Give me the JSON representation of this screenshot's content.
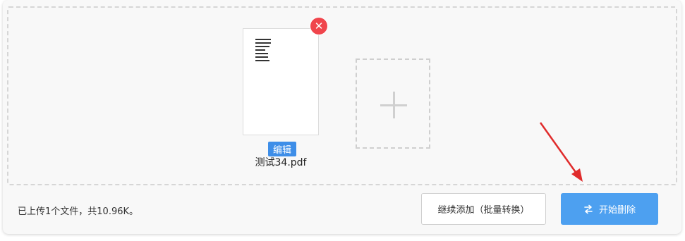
{
  "file": {
    "name": "测试34.pdf",
    "edit_label": "编辑",
    "remove_icon": "close-icon",
    "remove_symbol": "✕"
  },
  "add_tile": {
    "icon": "plus-icon"
  },
  "status": {
    "text": "已上传1个文件，共10.96K。"
  },
  "actions": {
    "batch_label": "继续添加（批量转换）",
    "start_label": "开始删除",
    "start_icon": "swap-icon"
  },
  "colors": {
    "accent": "#4da0f0",
    "badge": "#3e8ee8",
    "remove": "#f0454c",
    "annotation_arrow": "#e02b2b"
  }
}
